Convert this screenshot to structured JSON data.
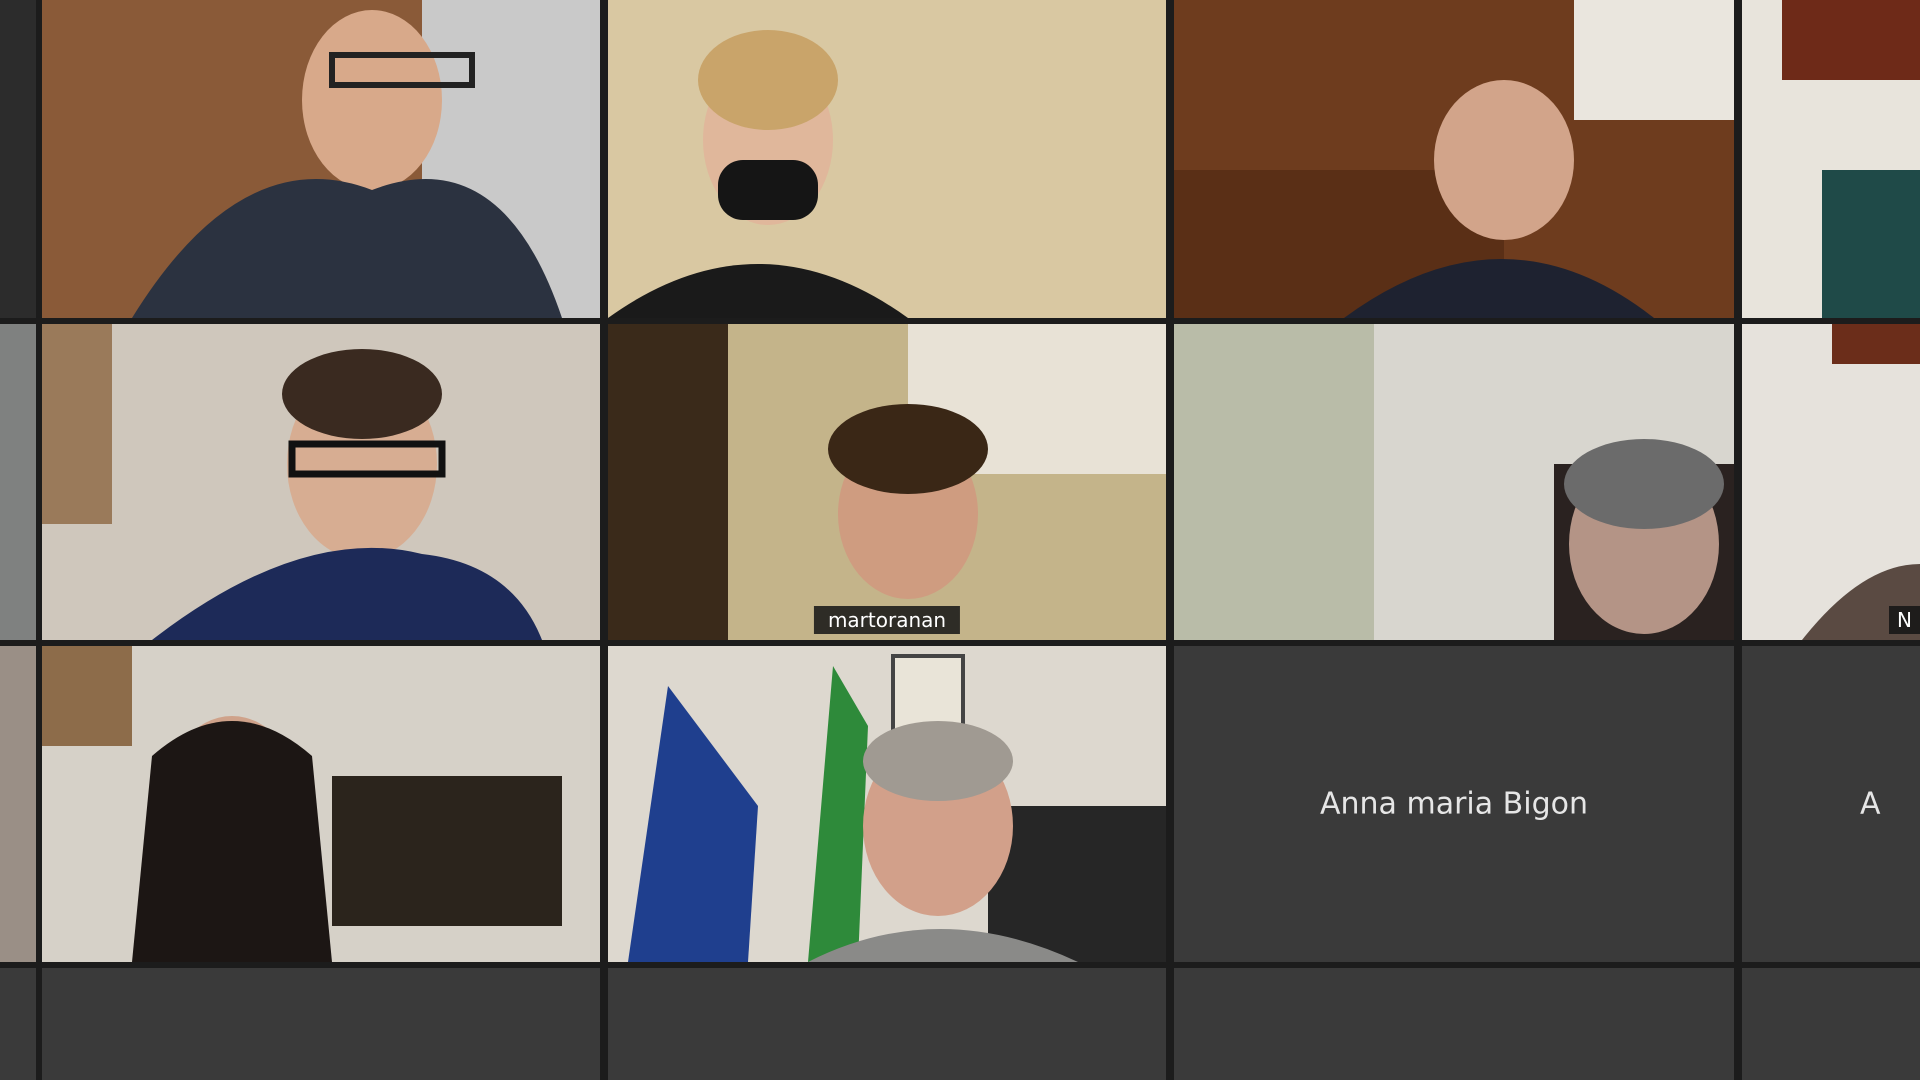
{
  "meeting": {
    "participants": [
      {
        "id": "p1",
        "label": "",
        "video": "on"
      },
      {
        "id": "p2",
        "label": "",
        "video": "on"
      },
      {
        "id": "p3",
        "label": "",
        "video": "on"
      },
      {
        "id": "p4",
        "label": "",
        "video": "on"
      },
      {
        "id": "p5",
        "label": "",
        "video": "on"
      },
      {
        "id": "p6",
        "label": "martoranan",
        "video": "on",
        "speaking": true
      },
      {
        "id": "p7",
        "label": "",
        "video": "on"
      },
      {
        "id": "p8",
        "label": "N",
        "video": "on"
      },
      {
        "id": "p9",
        "label": "",
        "video": "on"
      },
      {
        "id": "p10",
        "label": "",
        "video": "on"
      },
      {
        "id": "p11",
        "label": "Anna maria Bigon",
        "video": "off"
      },
      {
        "id": "p12",
        "label": "A",
        "video": "off"
      }
    ]
  },
  "colors": {
    "active_border": "#3ec7e6",
    "tile_bg": "#3a3a3a",
    "gap_bg": "#1c1c1c"
  }
}
